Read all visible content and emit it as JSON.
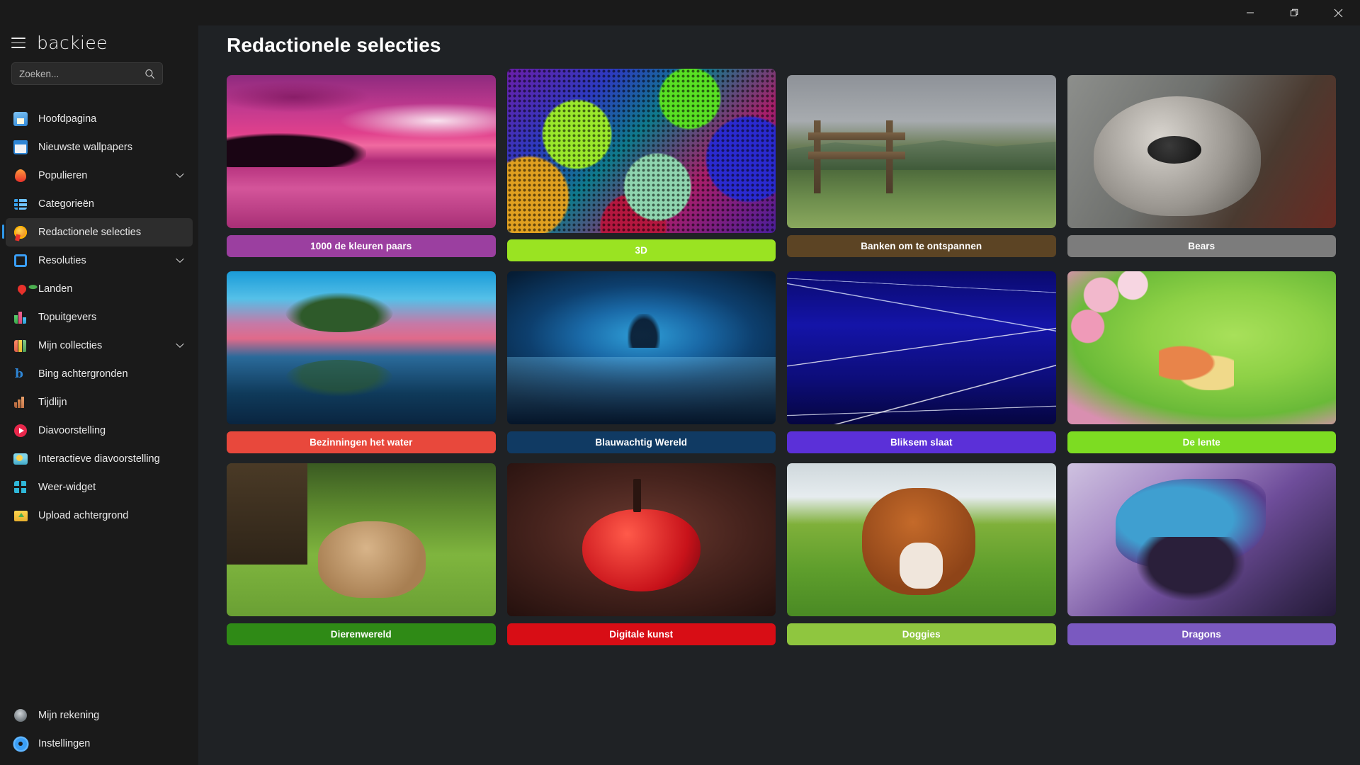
{
  "window": {
    "controls": [
      {
        "name": "minimize",
        "glyph": "minimize-icon"
      },
      {
        "name": "maximize",
        "glyph": "maximize-icon"
      },
      {
        "name": "close",
        "glyph": "close-icon"
      }
    ]
  },
  "sidebar": {
    "back_icon": "back-arrow-icon",
    "menu_icon": "hamburger-icon",
    "brand": "backiee",
    "search": {
      "placeholder": "Zoeken...",
      "value": "",
      "icon": "search-icon"
    },
    "items": [
      {
        "label": "Hoofdpagina",
        "icon": "home-icon",
        "chevron": false,
        "active": false
      },
      {
        "label": "Nieuwste wallpapers",
        "icon": "calendar-icon",
        "chevron": false,
        "active": false
      },
      {
        "label": "Populieren",
        "icon": "fire-icon",
        "chevron": true,
        "active": false
      },
      {
        "label": "Categorieën",
        "icon": "list-icon",
        "chevron": false,
        "active": false
      },
      {
        "label": "Redactionele selecties",
        "icon": "medal-icon",
        "chevron": false,
        "active": true
      },
      {
        "label": "Resoluties",
        "icon": "crop-icon",
        "chevron": true,
        "active": false
      },
      {
        "label": "Landen",
        "icon": "map-pin-icon",
        "chevron": false,
        "active": false
      },
      {
        "label": "Topuitgevers",
        "icon": "bar-chart-icon",
        "chevron": false,
        "active": false
      },
      {
        "label": "Mijn collecties",
        "icon": "books-icon",
        "chevron": true,
        "active": false
      },
      {
        "label": "Bing achtergronden",
        "icon": "bing-icon",
        "chevron": false,
        "active": false
      },
      {
        "label": "Tijdlijn",
        "icon": "timeline-icon",
        "chevron": false,
        "active": false
      },
      {
        "label": "Diavoorstelling",
        "icon": "play-icon",
        "chevron": false,
        "active": false
      },
      {
        "label": "Interactieve diavoorstelling",
        "icon": "weather-icon",
        "chevron": false,
        "active": false
      },
      {
        "label": "Weer-widget",
        "icon": "grid-icon",
        "chevron": false,
        "active": false
      },
      {
        "label": "Upload achtergrond",
        "icon": "upload-icon",
        "chevron": false,
        "active": false
      }
    ],
    "bottom_items": [
      {
        "label": "Mijn rekening",
        "icon": "user-icon"
      },
      {
        "label": "Instellingen",
        "icon": "gear-icon"
      }
    ]
  },
  "main": {
    "title": "Redactionele selecties",
    "cards": [
      {
        "label": "1000 de kleuren paars",
        "color": "#9b3fa0",
        "art": "ph-purple",
        "tall": false
      },
      {
        "label": "3D",
        "color": "#9ae322",
        "art": "ph-3d",
        "tall": true
      },
      {
        "label": "Banken om te ontspannen",
        "color": "#5c4424",
        "art": "ph-bench",
        "tall": false
      },
      {
        "label": "Bears",
        "color": "#7c7c7c",
        "art": "ph-koala",
        "tall": false
      },
      {
        "label": "Bezinningen het water",
        "color": "#e8483c",
        "art": "ph-bonsai",
        "tall": false
      },
      {
        "label": "Blauwachtig Wereld",
        "color": "#103a63",
        "art": "ph-blue",
        "tall": false
      },
      {
        "label": "Bliksem slaat",
        "color": "#5b30d8",
        "art": "ph-light",
        "tall": false
      },
      {
        "label": "De lente",
        "color": "#7ddc22",
        "art": "ph-spring",
        "tall": false
      },
      {
        "label": "Dierenwereld",
        "color": "#2f8a16",
        "art": "ph-deer",
        "tall": false
      },
      {
        "label": "Digitale kunst",
        "color": "#d80d15",
        "art": "ph-apple",
        "tall": false
      },
      {
        "label": "Doggies",
        "color": "#8fc63f",
        "art": "ph-dog",
        "tall": false
      },
      {
        "label": "Dragons",
        "color": "#7a59c0",
        "art": "ph-dragon",
        "tall": false
      }
    ]
  },
  "theme": {
    "sidebar_bg": "#1a1a1a",
    "content_bg": "#1f2225",
    "accent": "#2f97e8",
    "active_item_bg": "#2d2d2d"
  }
}
